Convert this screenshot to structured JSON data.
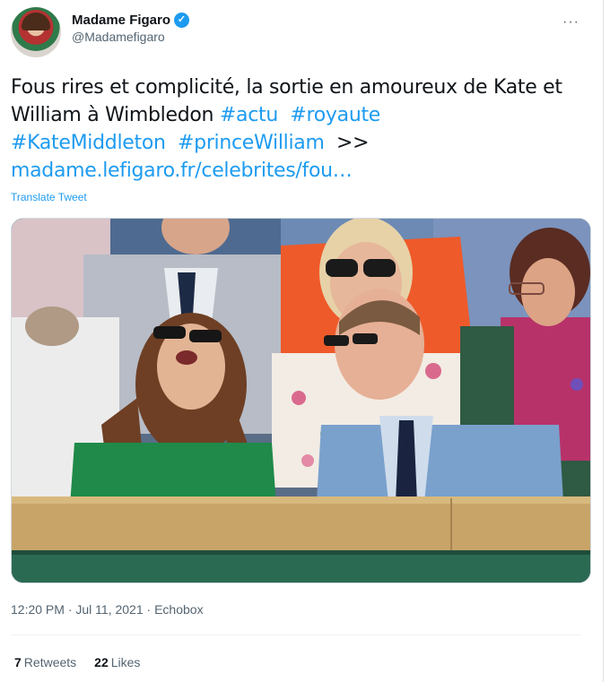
{
  "author": {
    "display_name": "Madame Figaro",
    "handle": "@Madamefigaro",
    "verified_icon": "✓"
  },
  "more_icon": "···",
  "tweet": {
    "text_plain": "Fous rires et complicité, la sortie en amoureux de Kate et William à Wimbledon ",
    "hashtags": [
      "#actu",
      "#royaute",
      "#KateMiddleton",
      "#princeWilliam"
    ],
    "arrows": " >>",
    "link": "madame.lefigaro.fr/celebrites/fou…",
    "translate_label": "Translate Tweet"
  },
  "meta": {
    "time": "12:20 PM",
    "date": "Jul 11, 2021",
    "source": "Echobox"
  },
  "stats": {
    "retweets_count": "7",
    "retweets_label": "Retweets",
    "likes_count": "22",
    "likes_label": "Likes"
  },
  "colors": {
    "accent": "#1d9bf0",
    "text": "#0f1419",
    "muted": "#536471"
  }
}
